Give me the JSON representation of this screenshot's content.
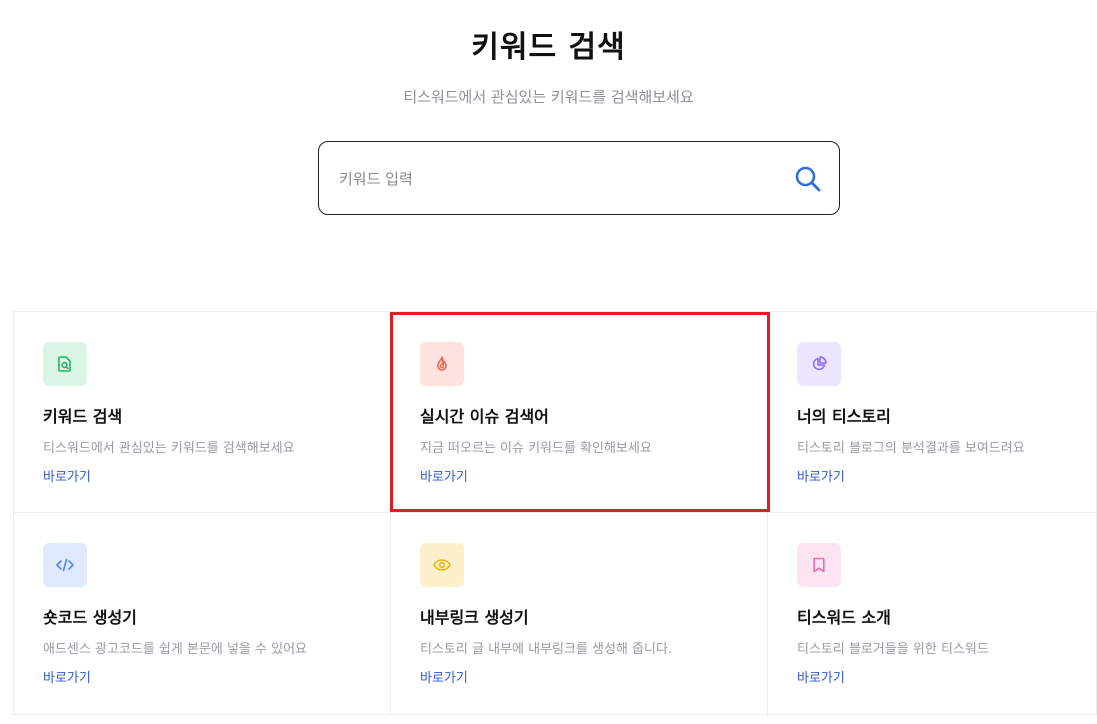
{
  "header": {
    "title": "키워드 검색",
    "subtitle": "티스워드에서 관심있는 키워드를 검색해보세요"
  },
  "search": {
    "placeholder": "키워드 입력",
    "value": "",
    "icon": "search-icon"
  },
  "colors": {
    "link": "#2f5bd3",
    "highlight_border": "#e01e24",
    "green_bg": "#d9f5e6",
    "green_fg": "#26b56a",
    "red_bg": "#fde2df",
    "red_fg": "#f0604d",
    "purple_bg": "#ebe6fd",
    "purple_fg": "#8c6cf0",
    "blue_bg": "#dfe9fd",
    "blue_fg": "#4e86ef",
    "yellow_bg": "#fdf1cb",
    "yellow_fg": "#e8b610",
    "pink_bg": "#fde4f1",
    "pink_fg": "#ee6aa9"
  },
  "cards": [
    {
      "title": "키워드 검색",
      "description": "티스워드에서 관심있는 키워드를 검색해보세요",
      "link": "바로가기",
      "icon": "file-search-icon"
    },
    {
      "title": "실시간 이슈 검색어",
      "description": "지금 떠오르는 이슈 키워드를 확인해보세요",
      "link": "바로가기",
      "icon": "fire-icon"
    },
    {
      "title": "너의 티스토리",
      "description": "티스토리 블로그의 분석결과를 보여드려요",
      "link": "바로가기",
      "icon": "pie-chart-icon"
    },
    {
      "title": "숏코드 생성기",
      "description": "애드센스 광고코드를 쉽게 본문에 넣을 수 있어요",
      "link": "바로가기",
      "icon": "code-icon"
    },
    {
      "title": "내부링크 생성기",
      "description": "티스토리 글 내부에 내부링크를 생성해 줍니다.",
      "link": "바로가기",
      "icon": "eye-icon"
    },
    {
      "title": "티스워드 소개",
      "description": "티스토리 블로거들을 위한 티스워드",
      "link": "바로가기",
      "icon": "bookmark-icon"
    }
  ]
}
